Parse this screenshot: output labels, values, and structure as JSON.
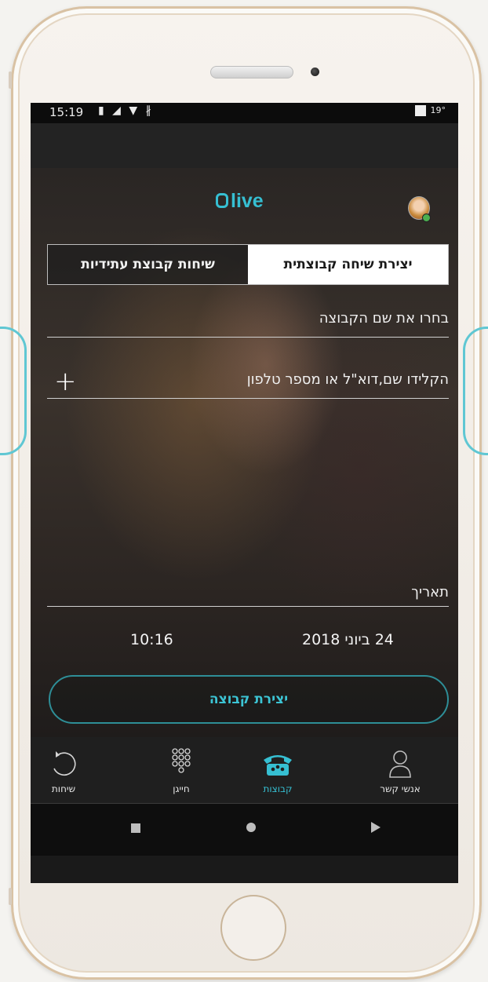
{
  "status_bar": {
    "time": "15:19",
    "temperature": "19°"
  },
  "app": {
    "logo_text": "live",
    "accent_color": "#36bfd2"
  },
  "tabs": [
    {
      "label": "יצירת שיחה קבוצתית",
      "active": true
    },
    {
      "label": "שיחות קבוצת עתידיות",
      "active": false
    }
  ],
  "form": {
    "group_name_placeholder": "בחרו את שם הקבוצה",
    "participants_placeholder": "הקלידו שם,דוא\"ל או מספר טלפון",
    "date_label": "תאריך",
    "time_value": "10:16",
    "date_value": "24 ביוני 2018",
    "create_button_label": "יצירת קבוצה"
  },
  "bottom_nav": [
    {
      "label": "אנשי קשר",
      "icon": "person-icon",
      "active": false
    },
    {
      "label": "קבוצות",
      "icon": "group-phone-icon",
      "active": true
    },
    {
      "label": "חייגן",
      "icon": "dialpad-icon",
      "active": false
    },
    {
      "label": "שיחות",
      "icon": "history-icon",
      "active": false
    }
  ],
  "system_nav": [
    "recents-icon",
    "home-icon",
    "back-icon"
  ]
}
